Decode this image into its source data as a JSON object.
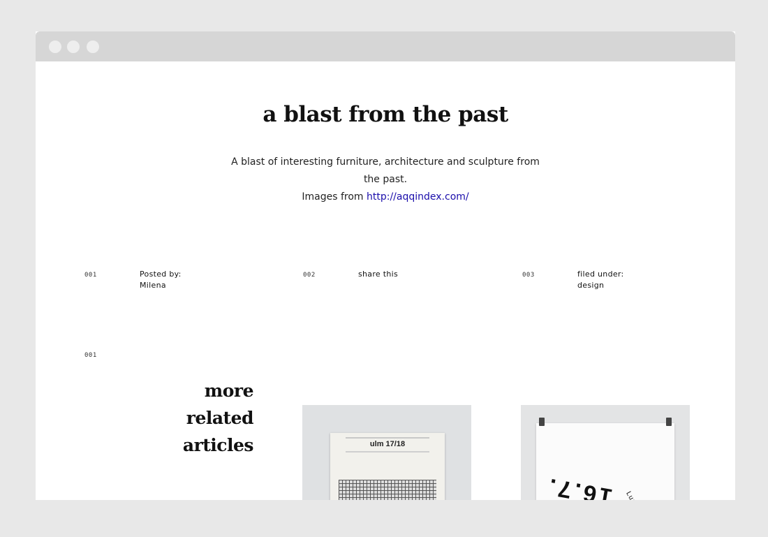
{
  "article": {
    "title": "a blast from the past",
    "description": "A blast of interesting furniture, architecture and sculpture from the past.",
    "images_prefix": "Images from",
    "images_link": "http://aqqindex.com/"
  },
  "meta": [
    {
      "num": "001",
      "label": "Posted by:",
      "value": "Milena"
    },
    {
      "num": "002",
      "label": "share this",
      "value": ""
    },
    {
      "num": "003",
      "label": "filed under:",
      "value": "design"
    }
  ],
  "related": {
    "num": "001",
    "title": "more related articles",
    "items": [
      {
        "cover_text": "ulm 17/18"
      },
      {
        "cover_text": "16.7.",
        "side_text": "Luzern"
      }
    ]
  },
  "colors": {
    "link": "#1a0dab",
    "window_chrome": "#d6d6d6",
    "page_bg": "#e8e8e8"
  },
  "icons": {
    "window_dots": [
      "window-dot-icon",
      "window-dot-icon",
      "window-dot-icon"
    ]
  }
}
